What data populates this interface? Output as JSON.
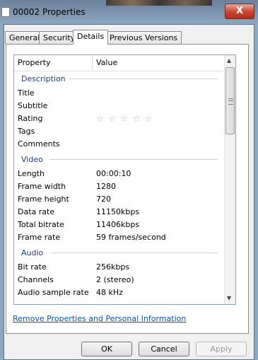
{
  "window": {
    "title": "00002 Properties",
    "close_label": "X"
  },
  "tabs": [
    {
      "label": "General"
    },
    {
      "label": "Security"
    },
    {
      "label": "Details",
      "active": true
    },
    {
      "label": "Previous Versions"
    }
  ],
  "details": {
    "col_property": "Property",
    "col_value": "Value",
    "groups": {
      "description": "Description",
      "video": "Video",
      "audio": "Audio"
    },
    "description": [
      {
        "prop": "Title",
        "value": ""
      },
      {
        "prop": "Subtitle",
        "value": ""
      },
      {
        "prop": "Rating",
        "rating": 0,
        "max": 5
      },
      {
        "prop": "Tags",
        "value": ""
      },
      {
        "prop": "Comments",
        "value": ""
      }
    ],
    "video": [
      {
        "prop": "Length",
        "value": "00:00:10"
      },
      {
        "prop": "Frame width",
        "value": "1280"
      },
      {
        "prop": "Frame height",
        "value": "720"
      },
      {
        "prop": "Data rate",
        "value": "11150kbps"
      },
      {
        "prop": "Total bitrate",
        "value": "11406kbps"
      },
      {
        "prop": "Frame rate",
        "value": "59 frames/second"
      }
    ],
    "audio": [
      {
        "prop": "Bit rate",
        "value": "256kbps"
      },
      {
        "prop": "Channels",
        "value": "2 (stereo)"
      },
      {
        "prop": "Audio sample rate",
        "value": "48 kHz"
      }
    ]
  },
  "link_text": "Remove Properties and Personal Information",
  "buttons": {
    "ok": "OK",
    "cancel": "Cancel",
    "apply": "Apply"
  },
  "icons": {
    "star": "☆",
    "scroll_up": "▲",
    "scroll_down": "▼"
  },
  "colors": {
    "group_heading": "#1e3b87",
    "link": "#0e4fa3",
    "close_button": "#c8452f"
  }
}
